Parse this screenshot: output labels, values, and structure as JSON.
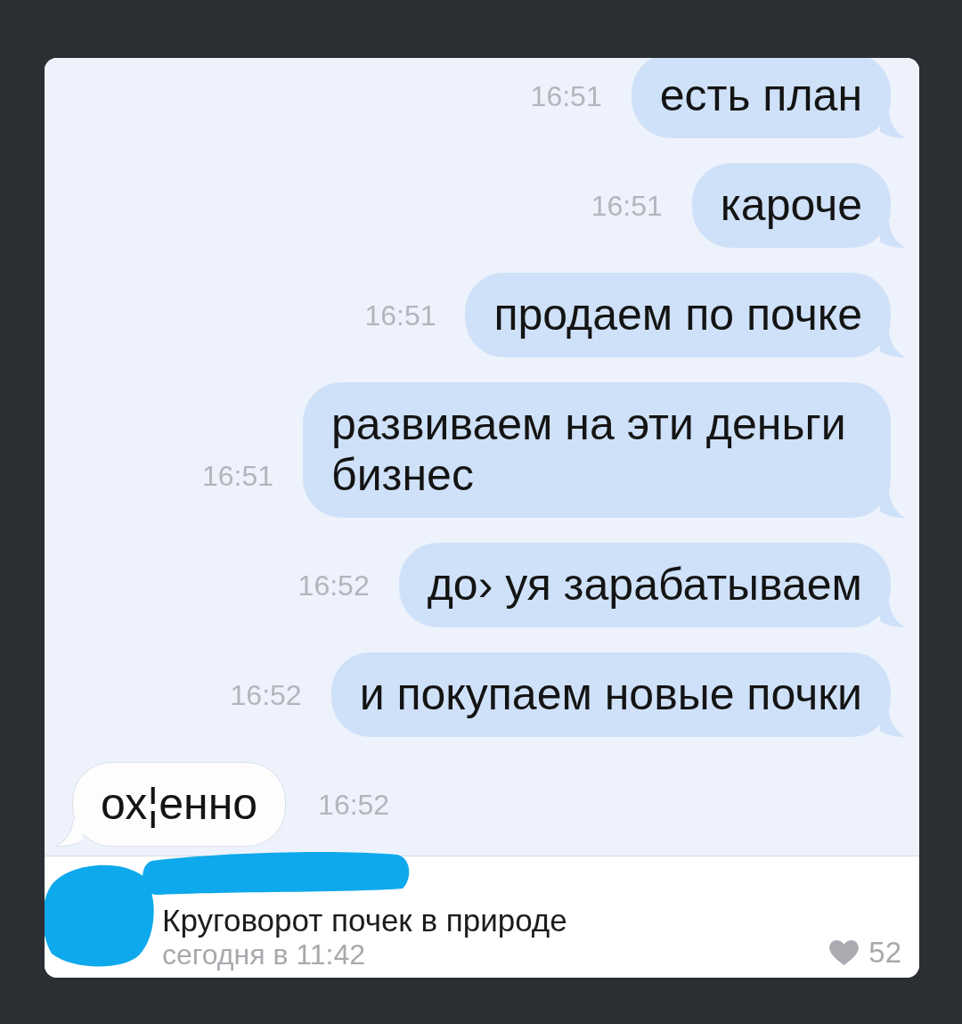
{
  "messages": [
    {
      "kind": "outgoing",
      "text": "есть план",
      "time": "16:51"
    },
    {
      "kind": "outgoing",
      "text": "кароче",
      "time": "16:51"
    },
    {
      "kind": "outgoing",
      "text": "продаем по почке",
      "time": "16:51"
    },
    {
      "kind": "outgoing",
      "text": "развиваем на эти деньги бизнес",
      "time": "16:51"
    },
    {
      "kind": "outgoing",
      "text": "до› уя зарабатываем",
      "time": "16:52"
    },
    {
      "kind": "outgoing",
      "text": "и покупаем новые почки",
      "time": "16:52"
    },
    {
      "kind": "incoming",
      "text": "ох¦енно",
      "time": "16:52"
    }
  ],
  "post": {
    "caption": "Круговорот почек в природе",
    "date": "сегодня в 11:42",
    "likes": "52"
  }
}
